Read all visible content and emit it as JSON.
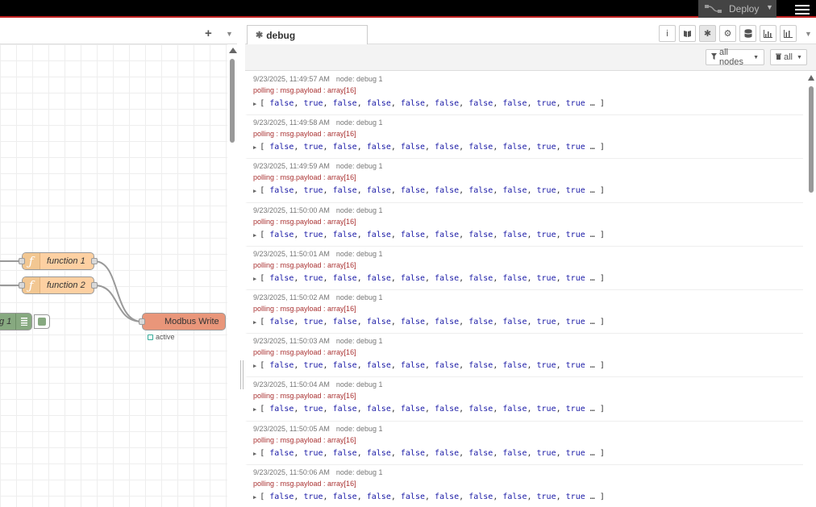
{
  "header": {
    "deploy_label": "Deploy",
    "deploy_caret": "▼",
    "menu_icon": "hamburger-icon"
  },
  "workspace": {
    "add_label": "+",
    "menu_caret": "▼",
    "nodes": {
      "function1": "function 1",
      "function2": "function 2",
      "modbus": "Modbus Write",
      "modbus_status": "active",
      "debug_partial": "g 1"
    },
    "function_icon": "ƒ"
  },
  "sidebar": {
    "tab_label": "debug",
    "tab_icon": "bug-icon",
    "buttons": [
      "info-icon",
      "book-icon",
      "bug-icon",
      "gear-icon",
      "database-icon",
      "chart-icon",
      "dashboard-icon"
    ],
    "menu_caret": "▼",
    "filter_label": "all nodes",
    "clear_label": "all"
  },
  "messages": [
    {
      "time": "9/23/2025, 11:49:57 AM",
      "node": "node: debug 1",
      "topic": "polling : msg.payload : array[16]"
    },
    {
      "time": "9/23/2025, 11:49:58 AM",
      "node": "node: debug 1",
      "topic": "polling : msg.payload : array[16]"
    },
    {
      "time": "9/23/2025, 11:49:59 AM",
      "node": "node: debug 1",
      "topic": "polling : msg.payload : array[16]"
    },
    {
      "time": "9/23/2025, 11:50:00 AM",
      "node": "node: debug 1",
      "topic": "polling : msg.payload : array[16]"
    },
    {
      "time": "9/23/2025, 11:50:01 AM",
      "node": "node: debug 1",
      "topic": "polling : msg.payload : array[16]"
    },
    {
      "time": "9/23/2025, 11:50:02 AM",
      "node": "node: debug 1",
      "topic": "polling : msg.payload : array[16]"
    },
    {
      "time": "9/23/2025, 11:50:03 AM",
      "node": "node: debug 1",
      "topic": "polling : msg.payload : array[16]"
    },
    {
      "time": "9/23/2025, 11:50:04 AM",
      "node": "node: debug 1",
      "topic": "polling : msg.payload : array[16]"
    },
    {
      "time": "9/23/2025, 11:50:05 AM",
      "node": "node: debug 1",
      "topic": "polling : msg.payload : array[16]"
    },
    {
      "time": "9/23/2025, 11:50:06 AM",
      "node": "node: debug 1",
      "topic": "polling : msg.payload : array[16]"
    }
  ],
  "payload_preview": [
    "false",
    "true",
    "false",
    "false",
    "false",
    "false",
    "false",
    "false",
    "true",
    "true"
  ],
  "payload_open": "[",
  "payload_close": "… ]",
  "colors": {
    "header_bg": "#000000",
    "header_accent": "#c02020",
    "function_node": "#fdd0a2",
    "modbus_node": "#e9967a",
    "debug_node": "#87a980",
    "topic_text": "#aa3333",
    "boolean_text": "#1a1aa6"
  }
}
